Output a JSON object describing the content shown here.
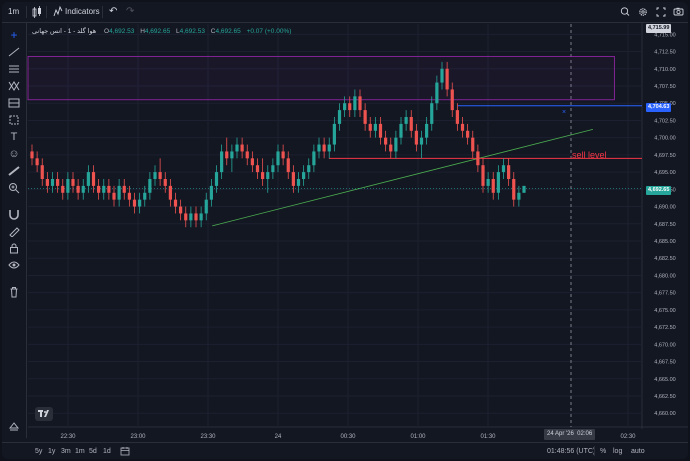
{
  "toolbar": {
    "interval": "1m",
    "indicators_label": "Indicators"
  },
  "legend": {
    "symbol": "هوا گلد - 1 - انس جهانی",
    "open_key": "O",
    "open": "4,692.53",
    "high_key": "H",
    "high": "4,692.65",
    "low_key": "L",
    "low": "4,692.53",
    "close_key": "C",
    "close": "4,692.65",
    "change": "+0.07 (+0.00%)"
  },
  "price_axis": {
    "ticks": [
      "4,715.00",
      "4,712.50",
      "4,710.00",
      "4,707.50",
      "4,705.00",
      "4,702.50",
      "4,700.00",
      "4,697.50",
      "4,695.00",
      "4,692.50",
      "4,690.00",
      "4,687.50",
      "4,685.00",
      "4,682.50",
      "4,680.00",
      "4,677.50",
      "4,675.00",
      "4,672.50",
      "4,670.00",
      "4,667.50",
      "4,665.00",
      "4,662.50",
      "4,660.00"
    ],
    "top_value": "4,715.99",
    "blue_line_label": "4,704.63",
    "current_price_label": "4,692.65"
  },
  "time_axis": {
    "ticks": [
      "22:30",
      "23:00",
      "23:30",
      "24",
      "00:30",
      "01:00",
      "01:30",
      "02:30"
    ],
    "crosshair_label": "24 Apr '26  02:06"
  },
  "annotations": {
    "sell_level": "sell level"
  },
  "colors": {
    "up": "#26a69a",
    "down": "#ef5350",
    "bg": "#131722",
    "trendline": "#4caf50",
    "rect": "#9c27b0",
    "blue_line": "#2962ff",
    "sell_line": "#f23645"
  },
  "bottombar": {
    "ranges": [
      "5y",
      "1y",
      "3m",
      "1m",
      "5d",
      "1d"
    ],
    "clock": "01:48:56 (UTC)",
    "pct": "%",
    "log": "log",
    "auto": "auto"
  },
  "chart_data": {
    "type": "candlestick",
    "y_range": [
      4658,
      4716.5
    ],
    "candles": [
      [
        4698,
        4699,
        4696,
        4697
      ],
      [
        4697,
        4698,
        4695,
        4696
      ],
      [
        4696,
        4697,
        4693,
        4694
      ],
      [
        4694,
        4695,
        4692,
        4693
      ],
      [
        4693,
        4695,
        4692,
        4694
      ],
      [
        4694,
        4695,
        4692,
        4693
      ],
      [
        4693,
        4694,
        4691,
        4692
      ],
      [
        4692,
        4695,
        4691,
        4694
      ],
      [
        4694,
        4695,
        4692,
        4693
      ],
      [
        4693,
        4694,
        4691,
        4692
      ],
      [
        4692,
        4694,
        4691,
        4693
      ],
      [
        4693,
        4696,
        4692,
        4695
      ],
      [
        4695,
        4696,
        4692,
        4693
      ],
      [
        4693,
        4694,
        4691,
        4692
      ],
      [
        4692,
        4694,
        4691,
        4693
      ],
      [
        4693,
        4694,
        4691,
        4692
      ],
      [
        4692,
        4693,
        4690,
        4691
      ],
      [
        4691,
        4694,
        4690,
        4693
      ],
      [
        4693,
        4694,
        4691,
        4692
      ],
      [
        4692,
        4693,
        4690,
        4691
      ],
      [
        4691,
        4692,
        4689,
        4690
      ],
      [
        4690,
        4692,
        4689,
        4691
      ],
      [
        4691,
        4693,
        4690,
        4692
      ],
      [
        4692,
        4695,
        4691,
        4694
      ],
      [
        4694,
        4696,
        4693,
        4695
      ],
      [
        4695,
        4697,
        4693,
        4694
      ],
      [
        4694,
        4695,
        4692,
        4693
      ],
      [
        4693,
        4694,
        4690,
        4691
      ],
      [
        4691,
        4692,
        4689,
        4690
      ],
      [
        4690,
        4691,
        4688,
        4689
      ],
      [
        4689,
        4690,
        4687,
        4688
      ],
      [
        4688,
        4690,
        4687,
        4689
      ],
      [
        4689,
        4690,
        4687,
        4688
      ],
      [
        4688,
        4690,
        4687,
        4689
      ],
      [
        4689,
        4692,
        4688,
        4691
      ],
      [
        4691,
        4694,
        4690,
        4693
      ],
      [
        4693,
        4696,
        4692,
        4695
      ],
      [
        4695,
        4699,
        4694,
        4698
      ],
      [
        4698,
        4700,
        4696,
        4697
      ],
      [
        4697,
        4699,
        4695,
        4698
      ],
      [
        4698,
        4700,
        4697,
        4699
      ],
      [
        4699,
        4700,
        4697,
        4698
      ],
      [
        4698,
        4699,
        4696,
        4697
      ],
      [
        4697,
        4698,
        4695,
        4696
      ],
      [
        4696,
        4697,
        4694,
        4695
      ],
      [
        4695,
        4697,
        4693,
        4694
      ],
      [
        4694,
        4696,
        4692,
        4695
      ],
      [
        4695,
        4697,
        4694,
        4696
      ],
      [
        4696,
        4699,
        4695,
        4698
      ],
      [
        4698,
        4699,
        4696,
        4697
      ],
      [
        4697,
        4698,
        4694,
        4695
      ],
      [
        4695,
        4696,
        4692,
        4693
      ],
      [
        4693,
        4695,
        4692,
        4694
      ],
      [
        4694,
        4696,
        4693,
        4695
      ],
      [
        4695,
        4697,
        4694,
        4696
      ],
      [
        4696,
        4699,
        4695,
        4698
      ],
      [
        4698,
        4700,
        4697,
        4699
      ],
      [
        4699,
        4700,
        4697,
        4698
      ],
      [
        4698,
        4700,
        4697,
        4699
      ],
      [
        4699,
        4703,
        4698,
        4702
      ],
      [
        4702,
        4705,
        4701,
        4704
      ],
      [
        4704,
        4706,
        4703,
        4705
      ],
      [
        4705,
        4706,
        4703,
        4704
      ],
      [
        4704,
        4707,
        4703,
        4706
      ],
      [
        4706,
        4707,
        4703,
        4704
      ],
      [
        4704,
        4705,
        4701,
        4702
      ],
      [
        4702,
        4703,
        4700,
        4701
      ],
      [
        4701,
        4703,
        4700,
        4702
      ],
      [
        4702,
        4703,
        4699,
        4700
      ],
      [
        4700,
        4701,
        4698,
        4699
      ],
      [
        4699,
        4700,
        4697,
        4698
      ],
      [
        4698,
        4701,
        4697,
        4700
      ],
      [
        4700,
        4703,
        4699,
        4702
      ],
      [
        4702,
        4704,
        4701,
        4703
      ],
      [
        4703,
        4704,
        4700,
        4701
      ],
      [
        4701,
        4702,
        4698,
        4699
      ],
      [
        4699,
        4701,
        4697,
        4700
      ],
      [
        4700,
        4703,
        4699,
        4702
      ],
      [
        4702,
        4706,
        4701,
        4705
      ],
      [
        4705,
        4709,
        4704,
        4708
      ],
      [
        4708,
        4711,
        4707,
        4710
      ],
      [
        4710,
        4711,
        4706,
        4707
      ],
      [
        4707,
        4708,
        4703,
        4704
      ],
      [
        4704,
        4705,
        4701,
        4702
      ],
      [
        4702,
        4703,
        4700,
        4701
      ],
      [
        4701,
        4702,
        4699,
        4700
      ],
      [
        4700,
        4701,
        4697,
        4698
      ],
      [
        4698,
        4699,
        4695,
        4696
      ],
      [
        4696,
        4697,
        4692,
        4693
      ],
      [
        4693,
        4695,
        4692,
        4694
      ],
      [
        4694,
        4695,
        4691,
        4692
      ],
      [
        4692,
        4696,
        4691,
        4695
      ],
      [
        4695,
        4697,
        4694,
        4696
      ],
      [
        4696,
        4697,
        4693,
        4694
      ],
      [
        4694,
        4695,
        4690,
        4691
      ],
      [
        4691,
        4693,
        4690,
        4692
      ],
      [
        4692,
        4693,
        4692,
        4693
      ]
    ],
    "drawings": {
      "trendline": {
        "from": [
          0.3,
          4687.2
        ],
        "to": [
          0.92,
          4701.2
        ]
      },
      "rectangle": {
        "x_from": 0.0,
        "x_to": 0.955,
        "y_top": 4711.8,
        "y_bottom": 4705.5
      },
      "blue_line": {
        "x_from": 0.7,
        "value": 4704.63
      },
      "sell_line": {
        "x_from": 0.49,
        "value": 4697.0
      }
    }
  }
}
